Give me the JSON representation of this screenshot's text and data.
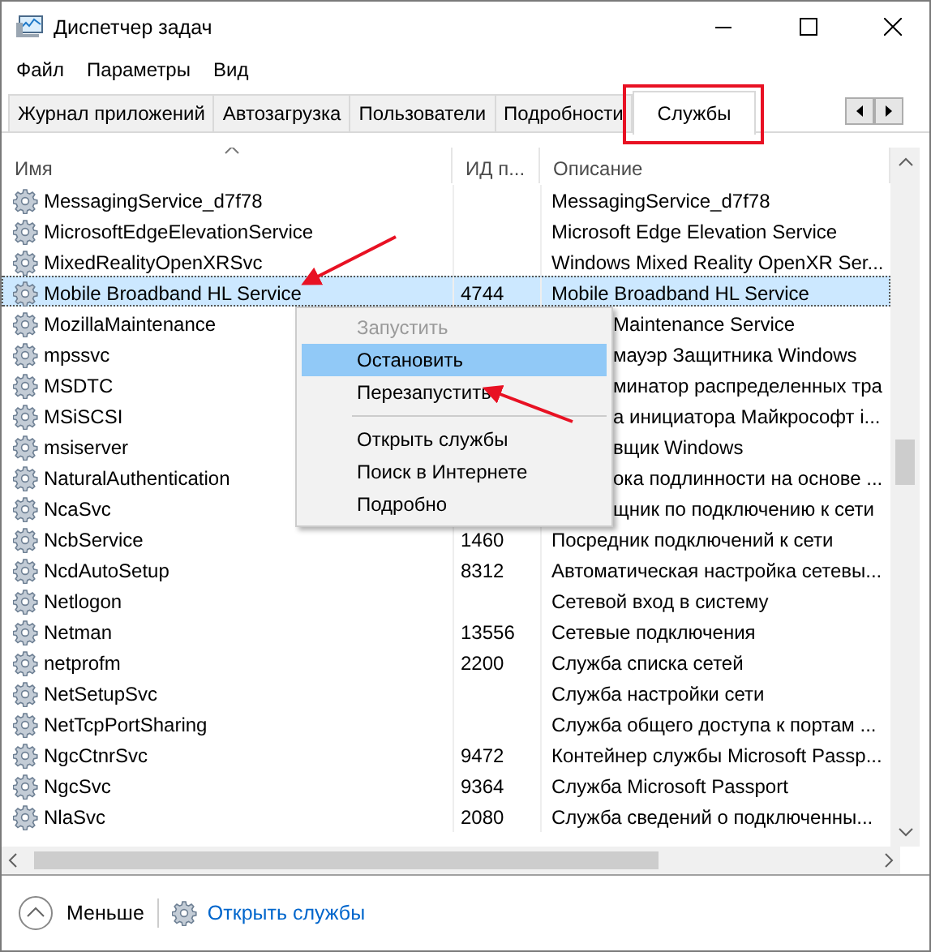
{
  "window": {
    "title": "Диспетчер задач"
  },
  "menu_bar": [
    "Файл",
    "Параметры",
    "Вид"
  ],
  "tabs": [
    {
      "label": "Журнал приложений",
      "selected": false
    },
    {
      "label": "Автозагрузка",
      "selected": false
    },
    {
      "label": "Пользователи",
      "selected": false
    },
    {
      "label": "Подробности",
      "selected": false
    },
    {
      "label": "Службы",
      "selected": true
    }
  ],
  "table": {
    "columns": [
      "Имя",
      "ИД п...",
      "Описание"
    ],
    "rows": [
      {
        "name": "MessagingService_d7f78",
        "pid": "",
        "description": "MessagingService_d7f78",
        "selected": false,
        "covered": false
      },
      {
        "name": "MicrosoftEdgeElevationService",
        "pid": "",
        "description": "Microsoft Edge Elevation Service",
        "selected": false,
        "covered": false
      },
      {
        "name": "MixedRealityOpenXRSvc",
        "pid": "",
        "description": "Windows Mixed Reality OpenXR Ser...",
        "selected": false,
        "covered": false
      },
      {
        "name": "Mobile Broadband HL Service",
        "pid": "4744",
        "description": "Mobile Broadband HL Service",
        "selected": true,
        "covered": false
      },
      {
        "name": "MozillaMaintenance",
        "pid": "",
        "description": "Maintenance Service",
        "selected": false,
        "covered": true
      },
      {
        "name": "mpssvc",
        "pid": "",
        "description": "мауэр Защитника Windows",
        "selected": false,
        "covered": true
      },
      {
        "name": "MSDTC",
        "pid": "",
        "description": "минатор распределенных тра",
        "selected": false,
        "covered": true
      },
      {
        "name": "MSiSCSI",
        "pid": "",
        "description": "а инициатора Майкрософт i...",
        "selected": false,
        "covered": true
      },
      {
        "name": "msiserver",
        "pid": "",
        "description": "вщик Windows",
        "selected": false,
        "covered": true
      },
      {
        "name": "NaturalAuthentication",
        "pid": "",
        "description": "ока подлинности на основе ...",
        "selected": false,
        "covered": true
      },
      {
        "name": "NcaSvc",
        "pid": "",
        "description": "щник по подключению к сети",
        "selected": false,
        "covered": true
      },
      {
        "name": "NcbService",
        "pid": "1460",
        "description": "Посредник подключений к сети",
        "selected": false,
        "covered": false
      },
      {
        "name": "NcdAutoSetup",
        "pid": "8312",
        "description": "Автоматическая настройка сетевы...",
        "selected": false,
        "covered": false
      },
      {
        "name": "Netlogon",
        "pid": "",
        "description": "Сетевой вход в систему",
        "selected": false,
        "covered": false
      },
      {
        "name": "Netman",
        "pid": "13556",
        "description": "Сетевые подключения",
        "selected": false,
        "covered": false
      },
      {
        "name": "netprofm",
        "pid": "2200",
        "description": "Служба списка сетей",
        "selected": false,
        "covered": false
      },
      {
        "name": "NetSetupSvc",
        "pid": "",
        "description": "Служба настройки сети",
        "selected": false,
        "covered": false
      },
      {
        "name": "NetTcpPortSharing",
        "pid": "",
        "description": "Служба общего доступа к портам ...",
        "selected": false,
        "covered": false
      },
      {
        "name": "NgcCtnrSvc",
        "pid": "9472",
        "description": "Контейнер службы Microsoft Passp...",
        "selected": false,
        "covered": false
      },
      {
        "name": "NgcSvc",
        "pid": "9364",
        "description": "Служба Microsoft Passport",
        "selected": false,
        "covered": false
      },
      {
        "name": "NlaSvc",
        "pid": "2080",
        "description": "Служба сведений о подключенны...",
        "selected": false,
        "covered": false
      }
    ]
  },
  "context_menu": {
    "items": [
      {
        "label": "Запустить",
        "disabled": true,
        "selected": false,
        "separator_before": false
      },
      {
        "label": "Остановить",
        "disabled": false,
        "selected": true,
        "separator_before": false
      },
      {
        "label": "Перезапустить",
        "disabled": false,
        "selected": false,
        "separator_before": false
      },
      {
        "label": "Открыть службы",
        "disabled": false,
        "selected": false,
        "separator_before": true
      },
      {
        "label": "Поиск в Интернете",
        "disabled": false,
        "selected": false,
        "separator_before": false
      },
      {
        "label": "Подробно",
        "disabled": false,
        "selected": false,
        "separator_before": false
      }
    ]
  },
  "footer": {
    "less": "Меньше",
    "open_services": "Открыть службы"
  }
}
